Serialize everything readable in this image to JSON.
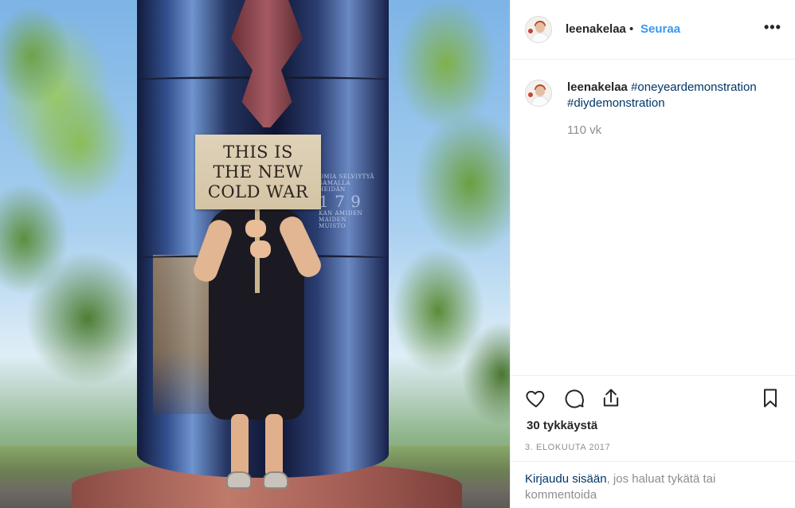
{
  "photo": {
    "sign_lines": [
      "THIS IS",
      "THE NEW",
      "COLD WAR"
    ]
  },
  "header": {
    "username": "leenakelaa",
    "separator": "•",
    "follow_label": "Seuraa",
    "more_label": "•••"
  },
  "caption": {
    "username": "leenakelaa",
    "hashtags": [
      "#oneyeardemonstration",
      "#diydemonstration"
    ],
    "time_ago": "110 vk"
  },
  "actions": {
    "icons": [
      "heart-icon",
      "comment-icon",
      "share-icon",
      "bookmark-icon"
    ]
  },
  "likes": "30 tykkäystä",
  "date": "3. ELOKUUTA 2017",
  "login": {
    "link": "Kirjaudu sisään",
    "text": ", jos haluat tykätä tai kommentoida"
  },
  "colors": {
    "link_blue": "#3897f0",
    "hashtag_blue": "#003569",
    "muted": "#8e8e8e",
    "divider": "#efefef"
  }
}
